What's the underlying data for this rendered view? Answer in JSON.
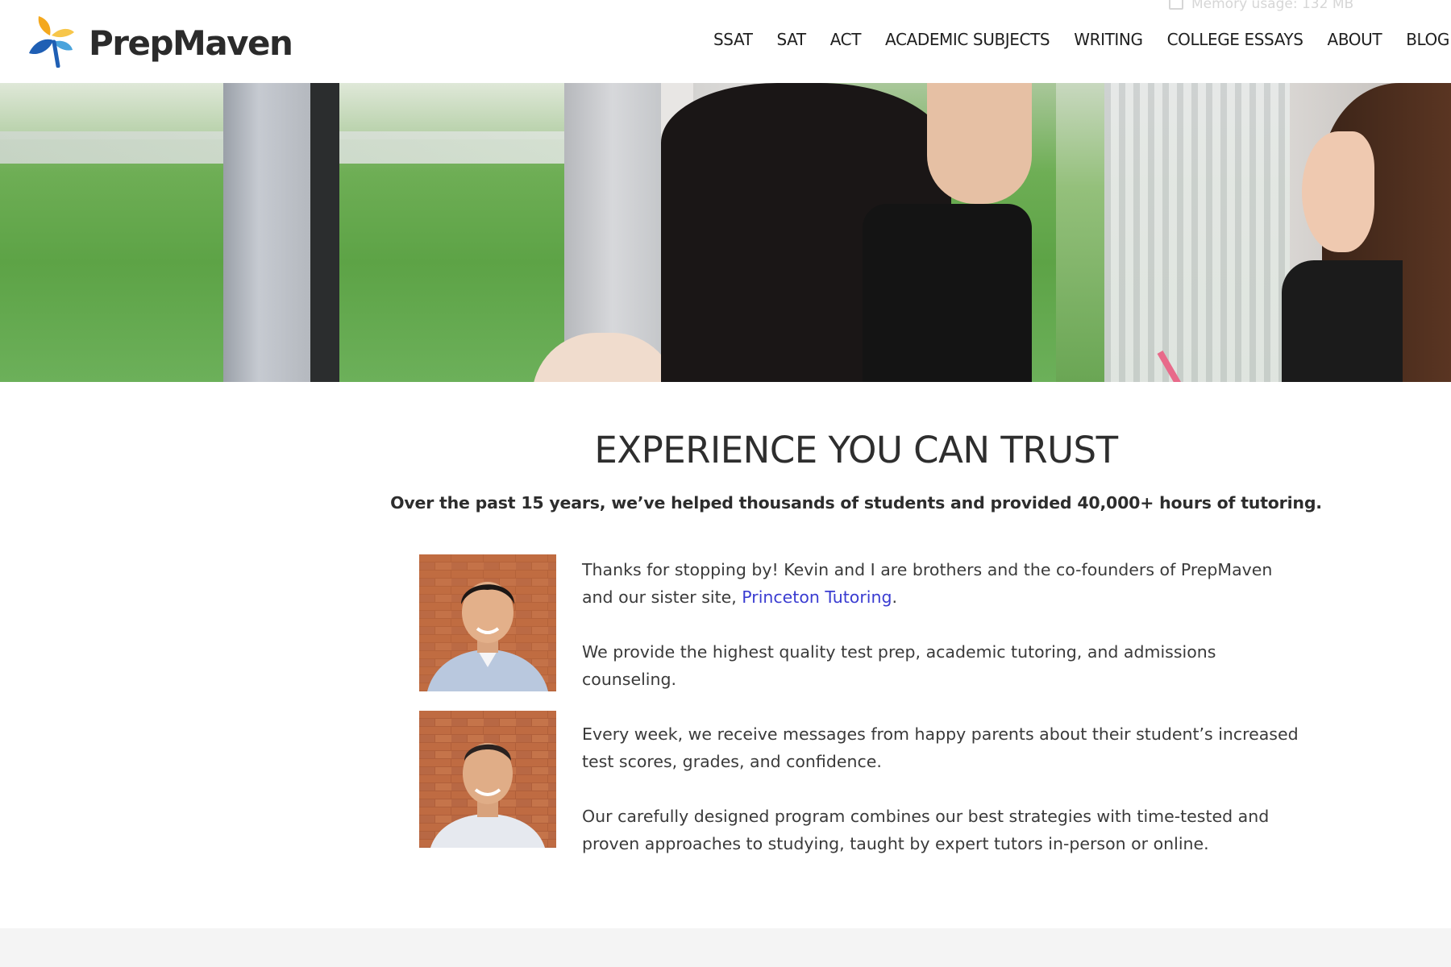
{
  "header": {
    "brand": "PrepMaven",
    "memory_text": "Memory usage: 132 MB",
    "nav": [
      "SSAT",
      "SAT",
      "ACT",
      "ACADEMIC SUBJECTS",
      "WRITING",
      "COLLEGE ESSAYS",
      "ABOUT",
      "BLOG"
    ]
  },
  "main": {
    "title": "EXPERIENCE YOU CAN TRUST",
    "subtitle": "Over the past 15 years, we’ve helped thousands of students and provided 40,000+ hours of tutoring.",
    "para1_before_link": "Thanks for stopping by! Kevin and I are brothers and the co-founders of PrepMaven and our sister site, ",
    "para1_link": "Princeton Tutoring",
    "para1_after_link": ".",
    "para2": "We provide the highest quality test prep, academic tutoring, and admissions counseling.",
    "para3": "Every week, we receive messages from happy parents about their student’s increased test scores, grades, and confidence.",
    "para4": "Our carefully designed program combines our best strategies with time-tested and proven approaches to studying, taught by expert tutors in-person or online."
  },
  "colors": {
    "link": "#3a3cd1",
    "logo_orange": "#f4a81d",
    "logo_blue": "#1f5fb4",
    "logo_light_blue": "#49a3dc"
  }
}
